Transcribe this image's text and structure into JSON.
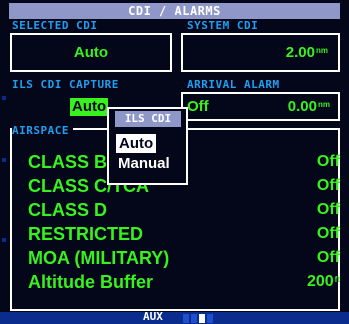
{
  "header": {
    "title": "CDI / ALARMS"
  },
  "selected_cdi": {
    "label": "SELECTED CDI",
    "value": "Auto"
  },
  "system_cdi": {
    "label": "SYSTEM CDI",
    "value": "2.00",
    "unit": "nm"
  },
  "ils_cdi_capture": {
    "label": "ILS CDI CAPTURE",
    "value": "Auto"
  },
  "arrival_alarm": {
    "label": "ARRIVAL ALARM",
    "state": "Off",
    "distance": "0.00",
    "unit": "nm"
  },
  "airspace": {
    "label": "AIRSPACE",
    "rows": [
      {
        "label": "CLASS B",
        "value": "Off"
      },
      {
        "label": "CLASS C/TCA",
        "value": "Off"
      },
      {
        "label": "CLASS D",
        "value": "Off"
      },
      {
        "label": "RESTRICTED",
        "value": "Off"
      },
      {
        "label": "MOA (MILITARY)",
        "value": "Off"
      },
      {
        "label": "Altitude Buffer",
        "value": "200",
        "unit": "ft"
      }
    ]
  },
  "popup": {
    "title": "ILS CDI",
    "options": [
      "Auto",
      "Manual"
    ],
    "selected": "Auto"
  },
  "status": {
    "page_group": "AUX",
    "pages_total": 4,
    "active_page": 3
  },
  "colors": {
    "background": "#04071a",
    "bezel": "#0a2c8c",
    "title_bar": "#8f97c9",
    "section_label": "#1e9ff2",
    "value_green": "#38f21e",
    "text_white": "#ffffff"
  }
}
